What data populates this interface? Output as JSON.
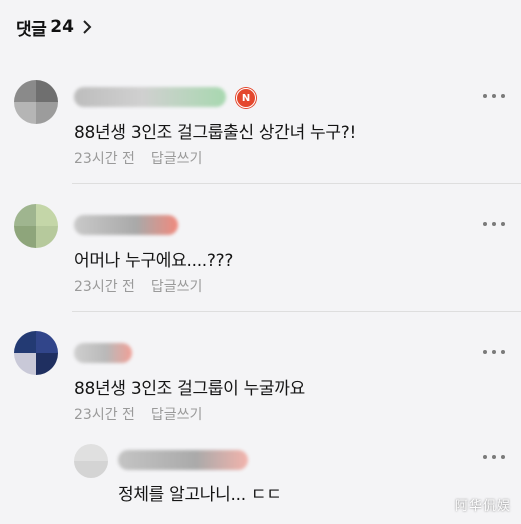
{
  "header": {
    "label": "댓글",
    "count": "24"
  },
  "comments": [
    {
      "text": "88년생 3인조 걸그룹출신 상간녀 누구?!",
      "time": "23시간 전",
      "reply_label": "답글쓰기",
      "badge": "N",
      "username_colors": [
        "#bdbdbd",
        "#d0d0d0",
        "#a8d8b0"
      ],
      "avatar_colors": [
        "#8a8a8a",
        "#6f6f6f",
        "#b5b5b5",
        "#9c9c9c"
      ]
    },
    {
      "text": "어머나 누구에요....???",
      "time": "23시간 전",
      "reply_label": "답글쓰기",
      "username_colors": [
        "#c9c9c9",
        "#a9a9a9",
        "#f08a7e"
      ],
      "avatar_colors": [
        "#9fb58f",
        "#c4d6a8",
        "#8ea57b",
        "#b6c99c"
      ]
    },
    {
      "text": "88년생 3인조 걸그룹이 누굴까요",
      "time": "23시간 전",
      "reply_label": "답글쓰기",
      "username_colors": [
        "#cfcfcf",
        "#b9b9b9",
        "#f0a097"
      ],
      "avatar_colors": [
        "#233a73",
        "#31458a",
        "#c9c9d8",
        "#1f2f60"
      ]
    }
  ],
  "reply": {
    "text": "정체를 알고나니... ㄷㄷ",
    "username_colors": [
      "#c4c4c4",
      "#aaaaaa",
      "#f2b3ac"
    ],
    "avatar_colors": [
      "#e0e0e0",
      "#d4d4d4"
    ]
  },
  "watermark": "阿华侃娱"
}
